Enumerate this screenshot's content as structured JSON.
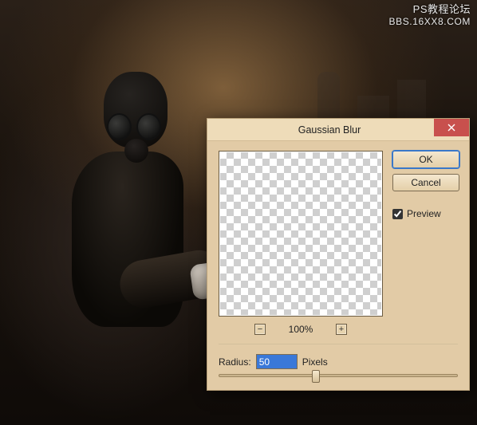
{
  "watermark": {
    "line1": "PS教程论坛",
    "line2": "BBS.16XX8.COM"
  },
  "dialog": {
    "title": "Gaussian Blur",
    "ok_label": "OK",
    "cancel_label": "Cancel",
    "preview_label": "Preview",
    "preview_checked": true,
    "zoom": {
      "minus": "⊟",
      "plus": "⊞",
      "level": "100%"
    },
    "radius": {
      "label": "Radius:",
      "value": "50",
      "unit": "Pixels"
    }
  }
}
